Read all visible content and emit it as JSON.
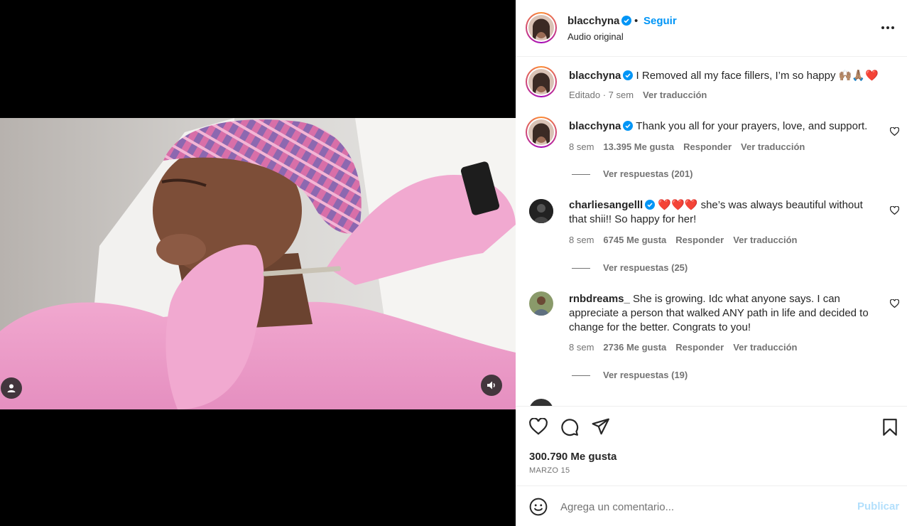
{
  "header": {
    "username": "blacchyna",
    "separator": "•",
    "follow_label": "Seguir",
    "subtitle": "Audio original",
    "more_icon": "more-horizontal-icon"
  },
  "caption": {
    "username": "blacchyna",
    "text": "I Removed all my face fillers, I’m so happy 🙌🏽🙏🏽❤️",
    "edited": "Editado · 7 sem",
    "translate": "Ver traducción"
  },
  "comments": [
    {
      "username": "blacchyna",
      "verified": true,
      "text": "Thank you all for your prayers, love, and support.",
      "time": "8 sem",
      "likes": "13.395 Me gusta",
      "reply": "Responder",
      "translate": "Ver traducción",
      "view_replies": "Ver respuestas (201)"
    },
    {
      "username": "charliesangelll",
      "verified": true,
      "text": "❤️❤️❤️ she’s was always beautiful without that shii!! So happy for her!",
      "time": "8 sem",
      "likes": "6745 Me gusta",
      "reply": "Responder",
      "translate": "Ver traducción",
      "view_replies": "Ver respuestas (25)"
    },
    {
      "username": "rnbdreams_",
      "verified": false,
      "text": "She is growing. Idc what anyone says. I can appreciate a person that walked ANY path in life and decided to change for the better. Congrats to you!",
      "time": "8 sem",
      "likes": "2736 Me gusta",
      "reply": "Responder",
      "translate": "Ver traducción",
      "view_replies": "Ver respuestas (19)"
    }
  ],
  "actions": {
    "like_icon": "heart-icon",
    "comment_icon": "comment-icon",
    "share_icon": "send-icon",
    "save_icon": "bookmark-icon",
    "likes": "300.790 Me gusta",
    "date": "MARZO 15"
  },
  "composer": {
    "placeholder": "Agrega un comentario...",
    "post_label": "Publicar"
  },
  "colors": {
    "accent": "#0095f6",
    "verified": "#0095f6",
    "muted": "#737373",
    "post_disabled": "#b2dffc"
  }
}
